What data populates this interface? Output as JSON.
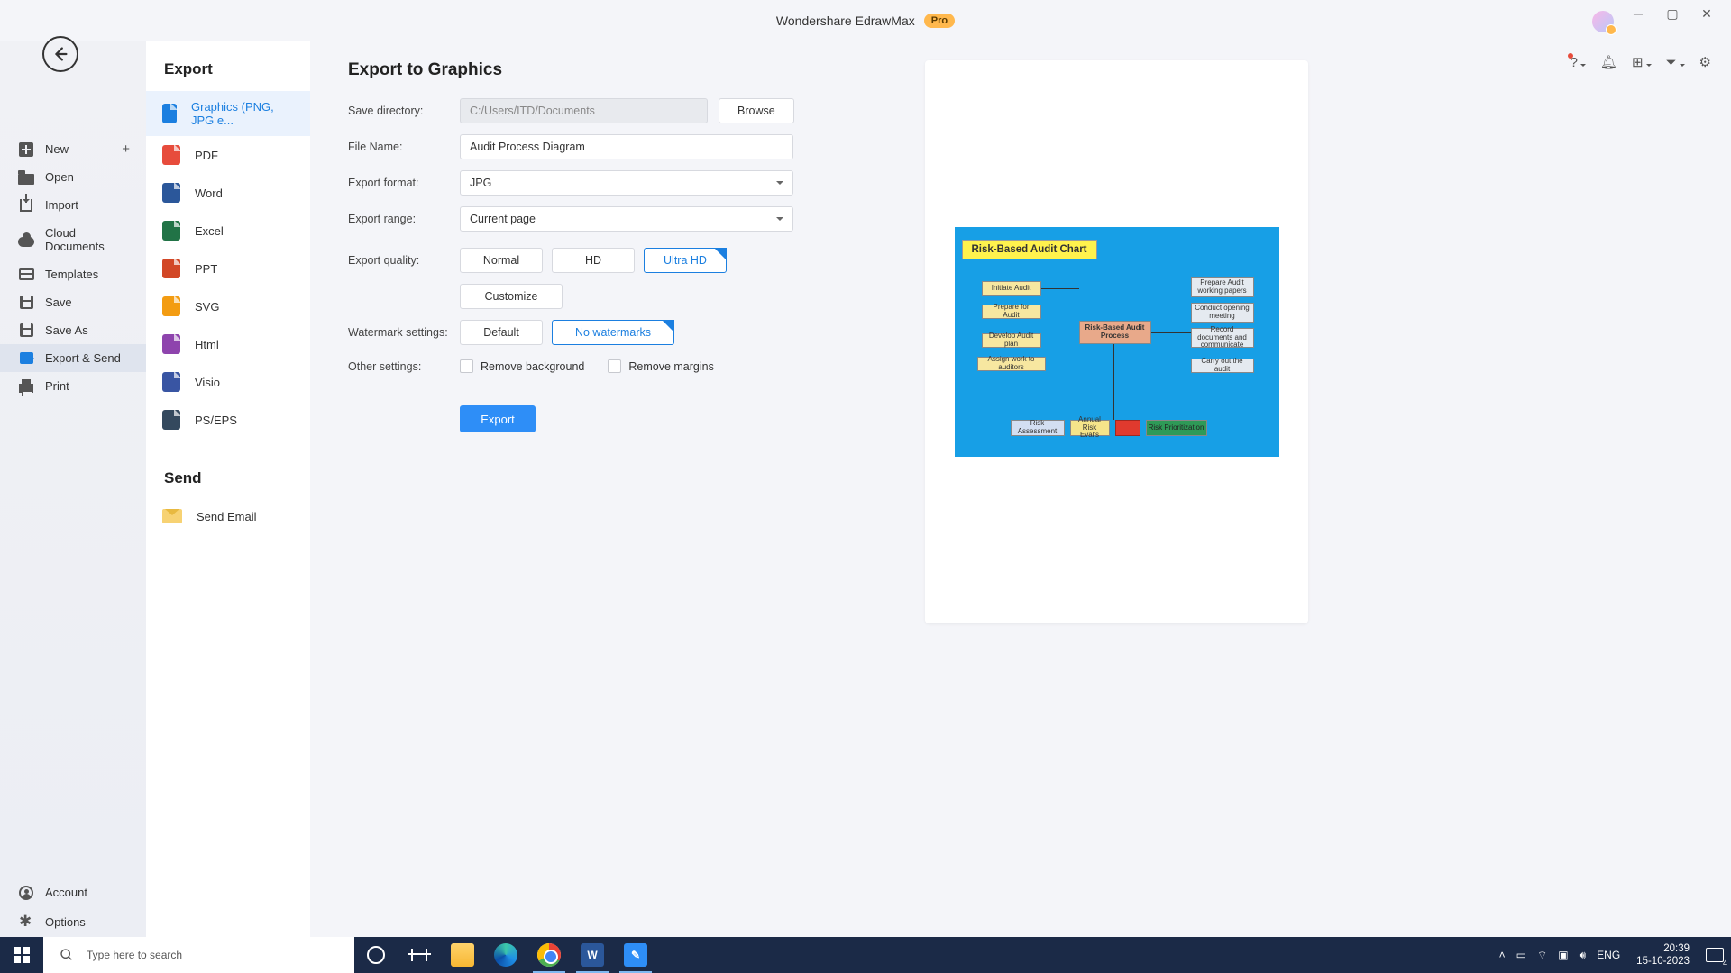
{
  "titlebar": {
    "app_name": "Wondershare EdrawMax",
    "pro": "Pro"
  },
  "sidebar1": {
    "items": [
      {
        "label": "New"
      },
      {
        "label": "Open"
      },
      {
        "label": "Import"
      },
      {
        "label": "Cloud Documents"
      },
      {
        "label": "Templates"
      },
      {
        "label": "Save"
      },
      {
        "label": "Save As"
      },
      {
        "label": "Export & Send"
      },
      {
        "label": "Print"
      }
    ],
    "bottom": [
      {
        "label": "Account"
      },
      {
        "label": "Options"
      }
    ]
  },
  "sidebar2": {
    "heading_export": "Export",
    "heading_send": "Send",
    "items": [
      {
        "label": "Graphics (PNG, JPG e...",
        "color": "#1b7fe0",
        "active": true
      },
      {
        "label": "PDF",
        "color": "#e74c3c"
      },
      {
        "label": "Word",
        "color": "#2b579a"
      },
      {
        "label": "Excel",
        "color": "#217346"
      },
      {
        "label": "PPT",
        "color": "#d24726"
      },
      {
        "label": "SVG",
        "color": "#f39c12"
      },
      {
        "label": "Html",
        "color": "#8e44ad"
      },
      {
        "label": "Visio",
        "color": "#3955a3"
      },
      {
        "label": "PS/EPS",
        "color": "#34495e"
      }
    ],
    "send_item": "Send Email"
  },
  "form": {
    "heading": "Export to Graphics",
    "save_dir_label": "Save directory:",
    "save_dir_value": "C:/Users/ITD/Documents",
    "browse": "Browse",
    "filename_label": "File Name:",
    "filename_value": "Audit Process Diagram",
    "format_label": "Export format:",
    "format_value": "JPG",
    "range_label": "Export range:",
    "range_value": "Current page",
    "quality_label": "Export quality:",
    "quality_options": [
      "Normal",
      "HD",
      "Ultra HD"
    ],
    "quality_selected": "Ultra HD",
    "customize": "Customize",
    "watermark_label": "Watermark settings:",
    "watermark_options": [
      "Default",
      "No watermarks"
    ],
    "watermark_selected": "No watermarks",
    "other_label": "Other settings:",
    "remove_bg": "Remove background",
    "remove_margins": "Remove margins",
    "export_btn": "Export"
  },
  "preview": {
    "title": "Risk-Based Audit Chart",
    "center": "Risk-Based Audit Process",
    "left": [
      "Initiate Audit",
      "Prepare for Audit",
      "Develop Audit plan",
      "Assign work to auditors"
    ],
    "right": [
      "Prepare Audit working papers",
      "Conduct opening meeting",
      "Record documents and communicate",
      "Carry out the audit"
    ],
    "bottom": [
      "Risk Assessment",
      "Annual Risk Eval's",
      "",
      "Risk Prioritization"
    ]
  },
  "taskbar": {
    "search_placeholder": "Type here to search",
    "lang": "ENG",
    "time": "20:39",
    "date": "15-10-2023",
    "notif_count": "4"
  }
}
